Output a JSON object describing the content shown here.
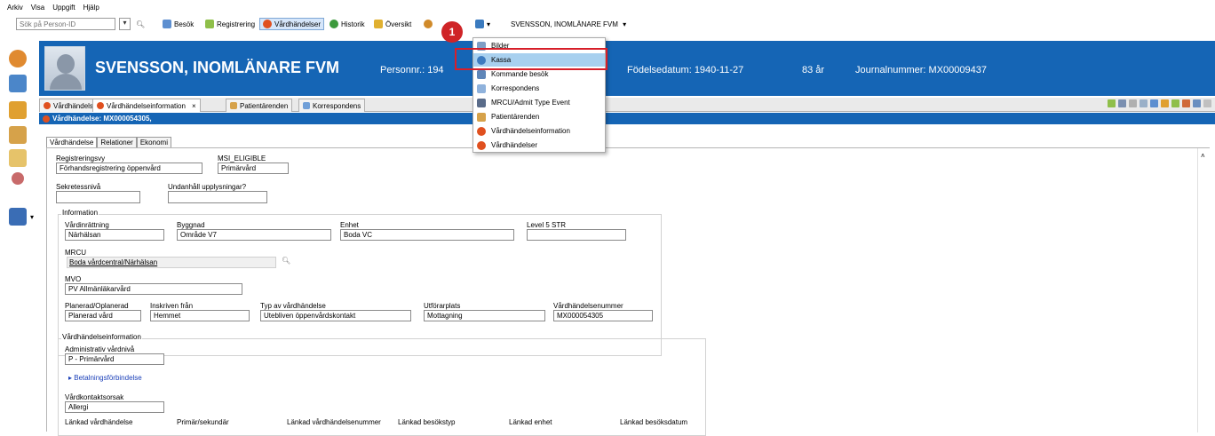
{
  "menu": [
    "Arkiv",
    "Visa",
    "Uppgift",
    "Hjälp"
  ],
  "toolbar": {
    "search_placeholder": "Sök på Person-ID",
    "buttons": [
      "Besök",
      "Registrering",
      "Vårdhändelser",
      "Historik",
      "Översikt"
    ],
    "patient_dropdown": "SVENSSON, INOMLÄNARE FVM"
  },
  "patient": {
    "name": "SVENSSON, INOMLÄNARE FVM",
    "personnr_label": "Personnr.: 194",
    "birth": "Födelsedatum: 1940-11-27",
    "age": "83 år",
    "journal": "Journalnummer: MX00009437"
  },
  "tabs": [
    "Vårdhändelser",
    "Vårdhändelseinformation",
    "Patientärenden",
    "Korrespondens"
  ],
  "tab_close": "×",
  "title_bar": "Vårdhändelse: MX000054305,",
  "subtabs": [
    "Vårdhändelse",
    "Relationer",
    "Ekonomi"
  ],
  "form": {
    "registreringsvy_label": "Registreringsvy",
    "registreringsvy_value": "Förhandsregistrering öppenvård",
    "msi_label": "MSI_ELIGIBLE",
    "msi_value": "Primärvård",
    "sekretess_label": "Sekretessnivå",
    "undanhall_label": "Undanhåll upplysningar?",
    "information_group": "Information",
    "vardinrattning_label": "Vårdinrättning",
    "vardinrattning_value": "Närhälsan",
    "byggnad_label": "Byggnad",
    "byggnad_value": "Område V7",
    "enhet_label": "Enhet",
    "enhet_value": "Boda VC",
    "level5_label": "Level 5 STR",
    "mrcu_label": "MRCU",
    "mrcu_value": "Boda vårdcentral/Närhälsan",
    "mvo_label": "MVO",
    "mvo_value": "PV Allmänläkarvård",
    "planerad_label": "Planerad/Oplanerad",
    "planerad_value": "Planerad vård",
    "inskriven_label": "Inskriven från",
    "inskriven_value": "Hemmet",
    "typ_label": "Typ av vårdhändelse",
    "typ_value": "Utebliven öppenvårdskontakt",
    "utforarplats_label": "Utförarplats",
    "utforarplats_value": "Mottagning",
    "vhnr_label": "Vårdhändelsenummer",
    "vhnr_value": "MX000054305",
    "vhinfo_group": "Vårdhändelseinformation",
    "admin_label": "Administrativ vårdnivå",
    "admin_value": "P - Primärvård",
    "betalning_link": "Betalningsförbindelse",
    "orsak_label": "Vårdkontaktsorsak",
    "orsak_value": "Allergi",
    "lankad_vh_label": "Länkad vårdhändelse",
    "primar_label": "Primär/sekundär",
    "lankad_nr_label": "Länkad vårdhändelsenummer",
    "lankad_typ_label": "Länkad besökstyp",
    "lankad_enhet_label": "Länkad enhet",
    "lankad_datum_label": "Länkad besöksdatum"
  },
  "dropdown_items": [
    "Bilder",
    "Kassa",
    "Kommande besök",
    "Korrespondens",
    "MRCU/Admit Type Event",
    "Patientärenden",
    "Vårdhändelseinformation",
    "Vårdhändelser"
  ],
  "step_badge": "1",
  "colors": {
    "header_blue": "#1565b5",
    "highlight_red": "#d71f2a",
    "selected_item": "#a8d0ef"
  }
}
